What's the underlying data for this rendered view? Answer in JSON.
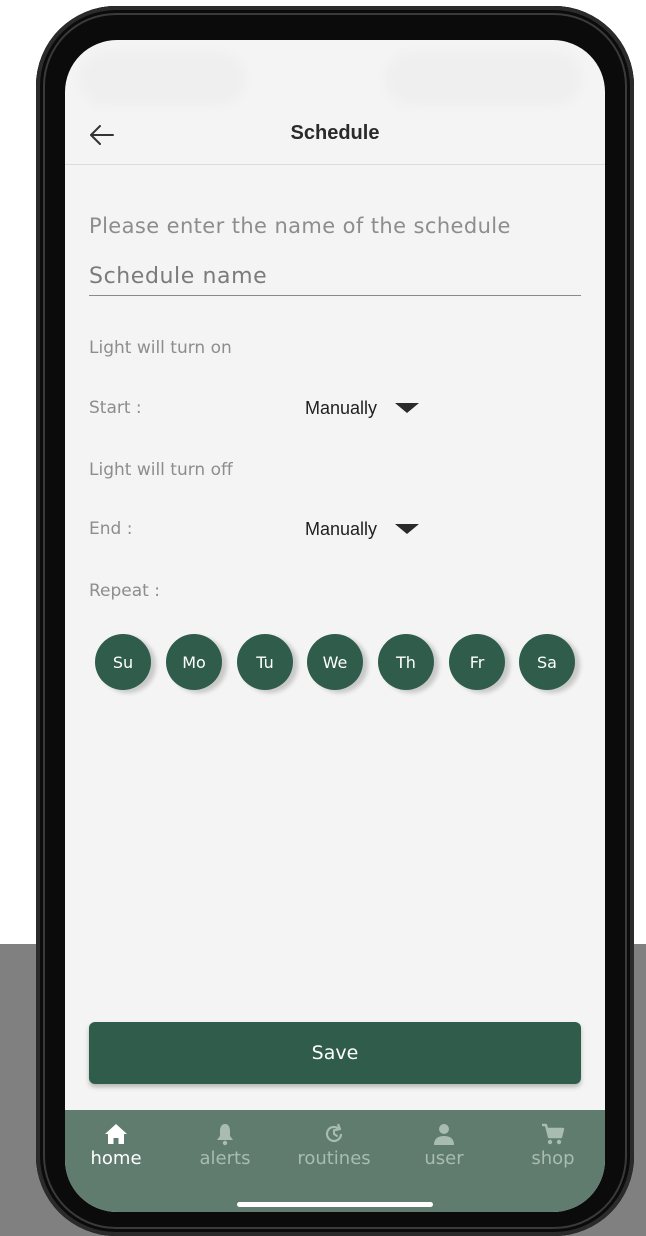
{
  "header": {
    "title": "Schedule"
  },
  "form": {
    "prompt": "Please enter the name of the schedule",
    "name_placeholder": "Schedule name",
    "name_value": "",
    "on_label": "Light will turn on",
    "start_label": "Start :",
    "start_value": "Manually",
    "off_label": "Light will turn off",
    "end_label": "End :",
    "end_value": "Manually",
    "repeat_label": "Repeat :"
  },
  "days": [
    "Su",
    "Mo",
    "Tu",
    "We",
    "Th",
    "Fr",
    "Sa"
  ],
  "save_label": "Save",
  "tabs": [
    {
      "label": "home",
      "icon": "home-icon",
      "active": true
    },
    {
      "label": "alerts",
      "icon": "bell-icon",
      "active": false
    },
    {
      "label": "routines",
      "icon": "history-icon",
      "active": false
    },
    {
      "label": "user",
      "icon": "user-icon",
      "active": false
    },
    {
      "label": "shop",
      "icon": "cart-icon",
      "active": false
    }
  ],
  "colors": {
    "primary": "#2f5c4b",
    "tabbar": "#5f7c6f",
    "tab_inactive": "#a9bcb2",
    "screen_bg": "#f4f4f4"
  }
}
